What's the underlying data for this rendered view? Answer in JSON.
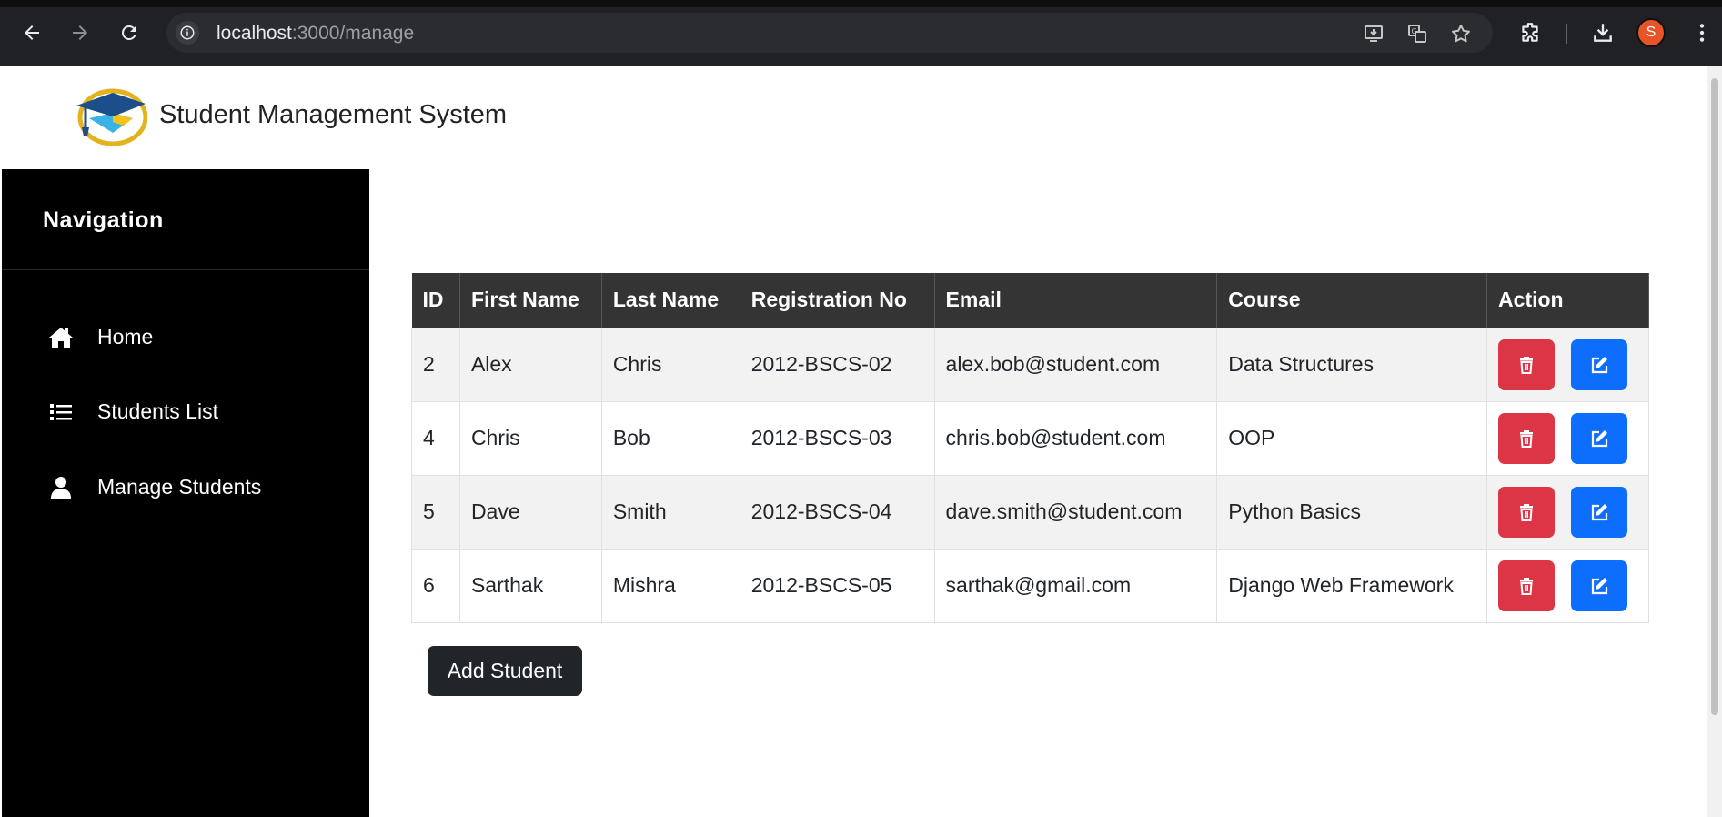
{
  "browser": {
    "url_host": "localhost",
    "url_path": ":3000/manage",
    "profile_initial": "S"
  },
  "header": {
    "title": "Student Management System"
  },
  "sidebar": {
    "title": "Navigation",
    "items": [
      {
        "label": "Home",
        "icon": "home-icon"
      },
      {
        "label": "Students List",
        "icon": "list-icon"
      },
      {
        "label": "Manage Students",
        "icon": "user-icon"
      }
    ]
  },
  "table": {
    "headers": [
      "ID",
      "First Name",
      "Last Name",
      "Registration No",
      "Email",
      "Course",
      "Action"
    ],
    "rows": [
      {
        "id": "2",
        "first": "Alex",
        "last": "Chris",
        "reg": "2012-BSCS-02",
        "email": "alex.bob@student.com",
        "course": "Data Structures"
      },
      {
        "id": "4",
        "first": "Chris",
        "last": "Bob",
        "reg": "2012-BSCS-03",
        "email": "chris.bob@student.com",
        "course": "OOP"
      },
      {
        "id": "5",
        "first": "Dave",
        "last": "Smith",
        "reg": "2012-BSCS-04",
        "email": "dave.smith@student.com",
        "course": "Python Basics"
      },
      {
        "id": "6",
        "first": "Sarthak",
        "last": "Mishra",
        "reg": "2012-BSCS-05",
        "email": "sarthak@gmail.com",
        "course": "Django Web Framework"
      }
    ]
  },
  "actions": {
    "add_label": "Add Student"
  },
  "colors": {
    "delete": "#dc3545",
    "edit": "#0d6efd",
    "header_bg": "#343434",
    "sidebar_bg": "#000000"
  }
}
